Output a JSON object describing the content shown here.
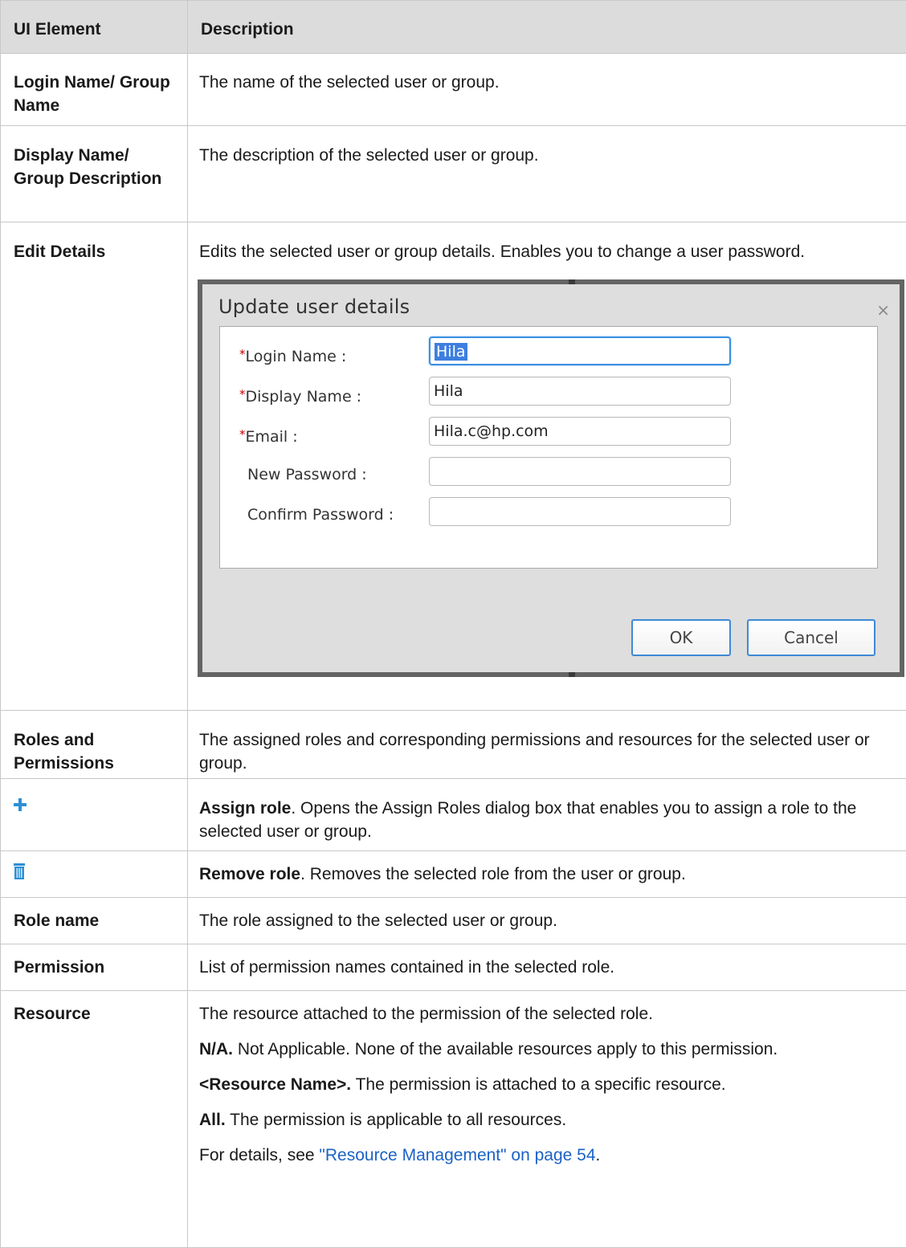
{
  "table": {
    "headers": {
      "element": "UI Element",
      "description": "Description"
    },
    "rows": {
      "login": {
        "element": "Login Name/ Group Name",
        "desc": "The name of the selected user or group."
      },
      "display": {
        "element": "Display Name/ Group Description",
        "desc": "The description of the selected user or group."
      },
      "edit": {
        "element": "Edit Details",
        "desc": "Edits the selected user or group details. Enables you to change a user password."
      },
      "roles": {
        "element": "Roles and Permissions",
        "desc": "The assigned roles and corresponding permissions and resources for the selected user or group."
      },
      "assign": {
        "icon": "plus-icon",
        "bold": "Assign role",
        "desc": ". Opens the Assign Roles dialog box that enables you to assign a role to the selected user or group."
      },
      "remove": {
        "icon": "trash-icon",
        "bold": "Remove role",
        "desc": ". Removes the selected role from the user or group."
      },
      "rolename": {
        "element": "Role name",
        "desc": "The role assigned to the selected user or group."
      },
      "permission": {
        "element": "Permission",
        "desc": "List of permission names contained in the selected role."
      },
      "resource": {
        "element": "Resource",
        "desc": "The resource attached to the permission of the selected role.",
        "na_bold": "N/A.",
        "na_text": " Not Applicable. None of the available resources apply to this permission.",
        "rn_bold": "<Resource Name>.",
        "rn_text": " The permission is attached to a specific resource.",
        "all_bold": "All.",
        "all_text": " The permission is applicable to all resources.",
        "details_prefix": "For details, see ",
        "details_link": "\"Resource Management\" on page 54",
        "details_suffix": "."
      }
    }
  },
  "dialog": {
    "title": "Update user details",
    "close": "×",
    "fields": {
      "login": {
        "label": "Login Name :",
        "value": "Hila",
        "required": "*"
      },
      "display": {
        "label": "Display Name :",
        "value": "Hila",
        "required": "*"
      },
      "email": {
        "label": "Email :",
        "value": "Hila.c@hp.com",
        "required": "*"
      },
      "new_password": {
        "label": "New Password :",
        "value": ""
      },
      "confirm_password": {
        "label": "Confirm Password :",
        "value": ""
      }
    },
    "ok": "OK",
    "cancel": "Cancel"
  },
  "colors": {
    "header_bg": "#dcdcdc",
    "border": "#c8c8c8",
    "link": "#1b62c6",
    "icon": "#2d8fd5",
    "focus": "#3a8fe0"
  }
}
